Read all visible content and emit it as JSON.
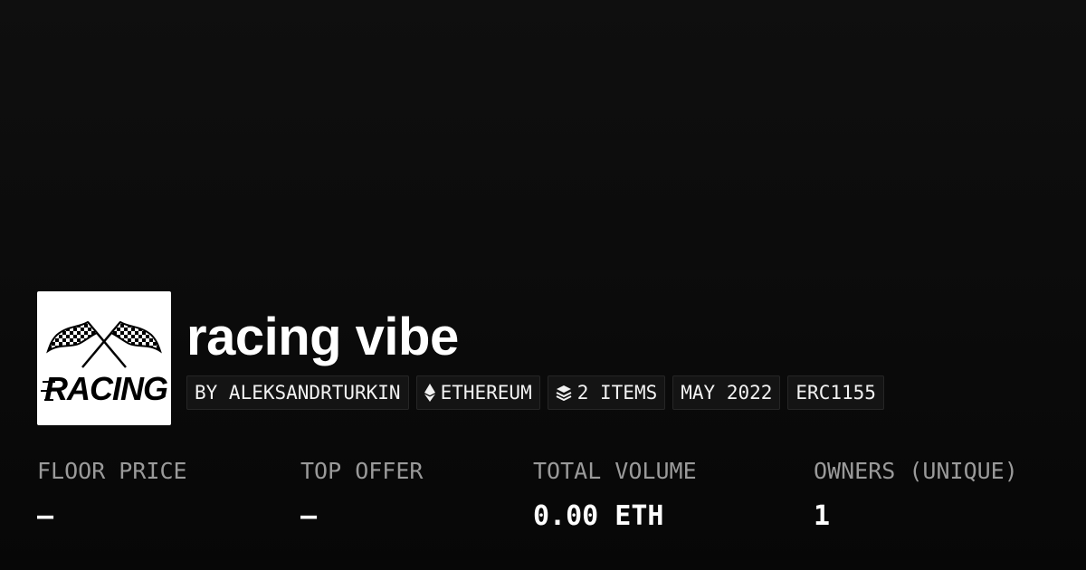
{
  "collection": {
    "name": "racing vibe",
    "logo_icon": "racing-checkered-flags-logo",
    "logo_text": "RACING"
  },
  "tags": [
    {
      "label": "BY ALEKSANDRTURKIN",
      "icon": ""
    },
    {
      "label": "ETHEREUM",
      "icon": "ethereum-icon"
    },
    {
      "label": "2 ITEMS",
      "icon": "layers-icon"
    },
    {
      "label": "MAY 2022",
      "icon": ""
    },
    {
      "label": "ERC1155",
      "icon": ""
    }
  ],
  "stats": [
    {
      "label": "FLOOR PRICE",
      "value": "–"
    },
    {
      "label": "TOP OFFER",
      "value": "–"
    },
    {
      "label": "TOTAL VOLUME",
      "value": "0.00 ETH"
    },
    {
      "label": "OWNERS (UNIQUE)",
      "value": "1"
    }
  ],
  "colors": {
    "background": "#0b0b0b",
    "text": "#ffffff",
    "muted": "#9a9a9a",
    "tag_bg": "#141414",
    "tag_border": "#262626"
  }
}
